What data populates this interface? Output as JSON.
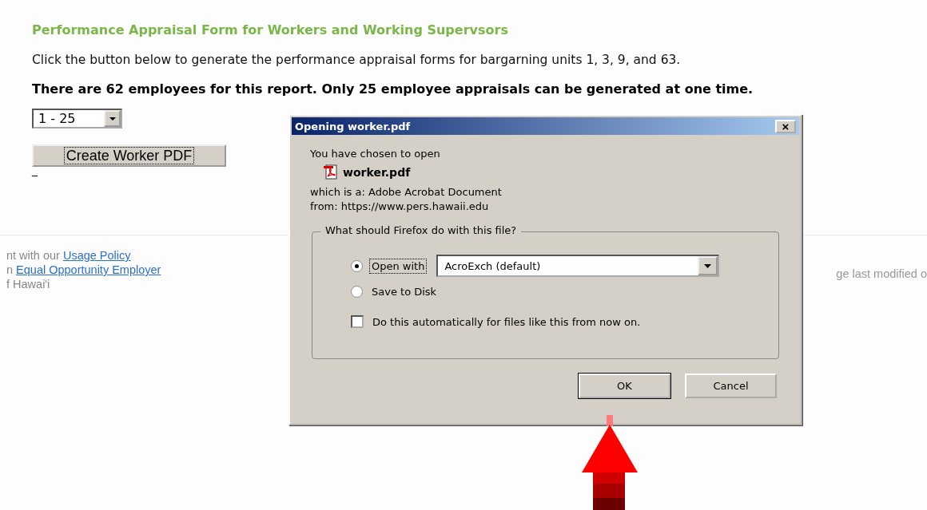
{
  "page": {
    "heading": "Performance Appraisal Form for Workers and Working Supervsors",
    "intro": "Click the button below to generate the performance appraisal forms for bargarning units 1, 3, 9, and 63.",
    "notice": "There are 62 employees for this report. Only 25 employee appraisals can be generated at one time.",
    "range_select": {
      "value": "1 - 25"
    },
    "create_button": "Create Worker PDF",
    "underscore": "_"
  },
  "footer": {
    "lines": [
      {
        "text": "nt with our",
        "link": "Usage Policy"
      },
      {
        "text": "n",
        "link": "Equal Opportunity Employer"
      },
      {
        "text": "f Hawai'i"
      }
    ],
    "modified": "ge last modified o"
  },
  "dialog": {
    "title": "Opening worker.pdf",
    "close": "×",
    "intro": "You have chosen to open",
    "file_name": "worker.pdf",
    "type_line": "which is a:  Adobe Acrobat Document",
    "from_line": "from:  https://www.pers.hawaii.edu",
    "group_title": "What should Firefox do with this file?",
    "options": [
      {
        "label": "Open with",
        "selected": true,
        "app": "AcroExch (default)"
      },
      {
        "label": "Save to Disk",
        "selected": false
      }
    ],
    "auto": {
      "label": "Do this automatically for files like this from now on.",
      "checked": false
    },
    "buttons": [
      {
        "label": "OK",
        "kind": "default"
      },
      {
        "label": "Cancel",
        "kind": "normal"
      }
    ]
  }
}
